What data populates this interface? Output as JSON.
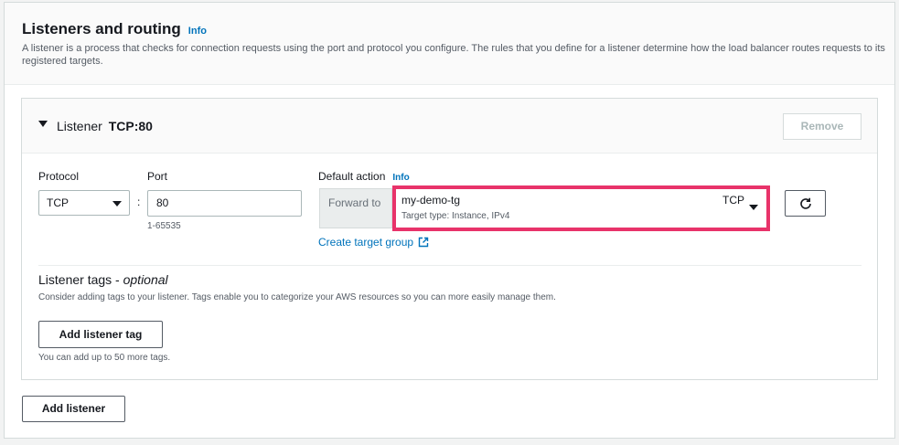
{
  "section": {
    "title": "Listeners and routing",
    "info": "Info",
    "description": "A listener is a process that checks for connection requests using the port and protocol you configure. The rules that you define for a listener determine how the load balancer routes requests to its registered targets."
  },
  "listener": {
    "label": "Listener",
    "name": "TCP:80",
    "remove_label": "Remove",
    "protocol_label": "Protocol",
    "protocol_value": "TCP",
    "colon": ":",
    "port_label": "Port",
    "port_value": "80",
    "port_hint": "1-65535",
    "default_action_label": "Default action",
    "default_action_info": "Info",
    "forward_to_label": "Forward to",
    "target_group": {
      "name": "my-demo-tg",
      "protocol": "TCP",
      "type": "Target type: Instance, IPv4"
    },
    "create_target_group_label": "Create target group",
    "tags": {
      "title": "Listener tags - ",
      "title_optional": "optional",
      "description": "Consider adding tags to your listener. Tags enable you to categorize your AWS resources so you can more easily manage them.",
      "add_label": "Add listener tag",
      "hint": "You can add up to 50 more tags."
    }
  },
  "add_listener_label": "Add listener",
  "icons": {
    "expand": "caret-down-icon",
    "dropdown": "chevron-down-icon",
    "external": "external-link-icon",
    "refresh": "refresh-icon"
  },
  "colors": {
    "link": "#0073bb",
    "highlight": "#e8336a",
    "border": "#d5dbdb",
    "text": "#16191f",
    "muted": "#545b64"
  }
}
